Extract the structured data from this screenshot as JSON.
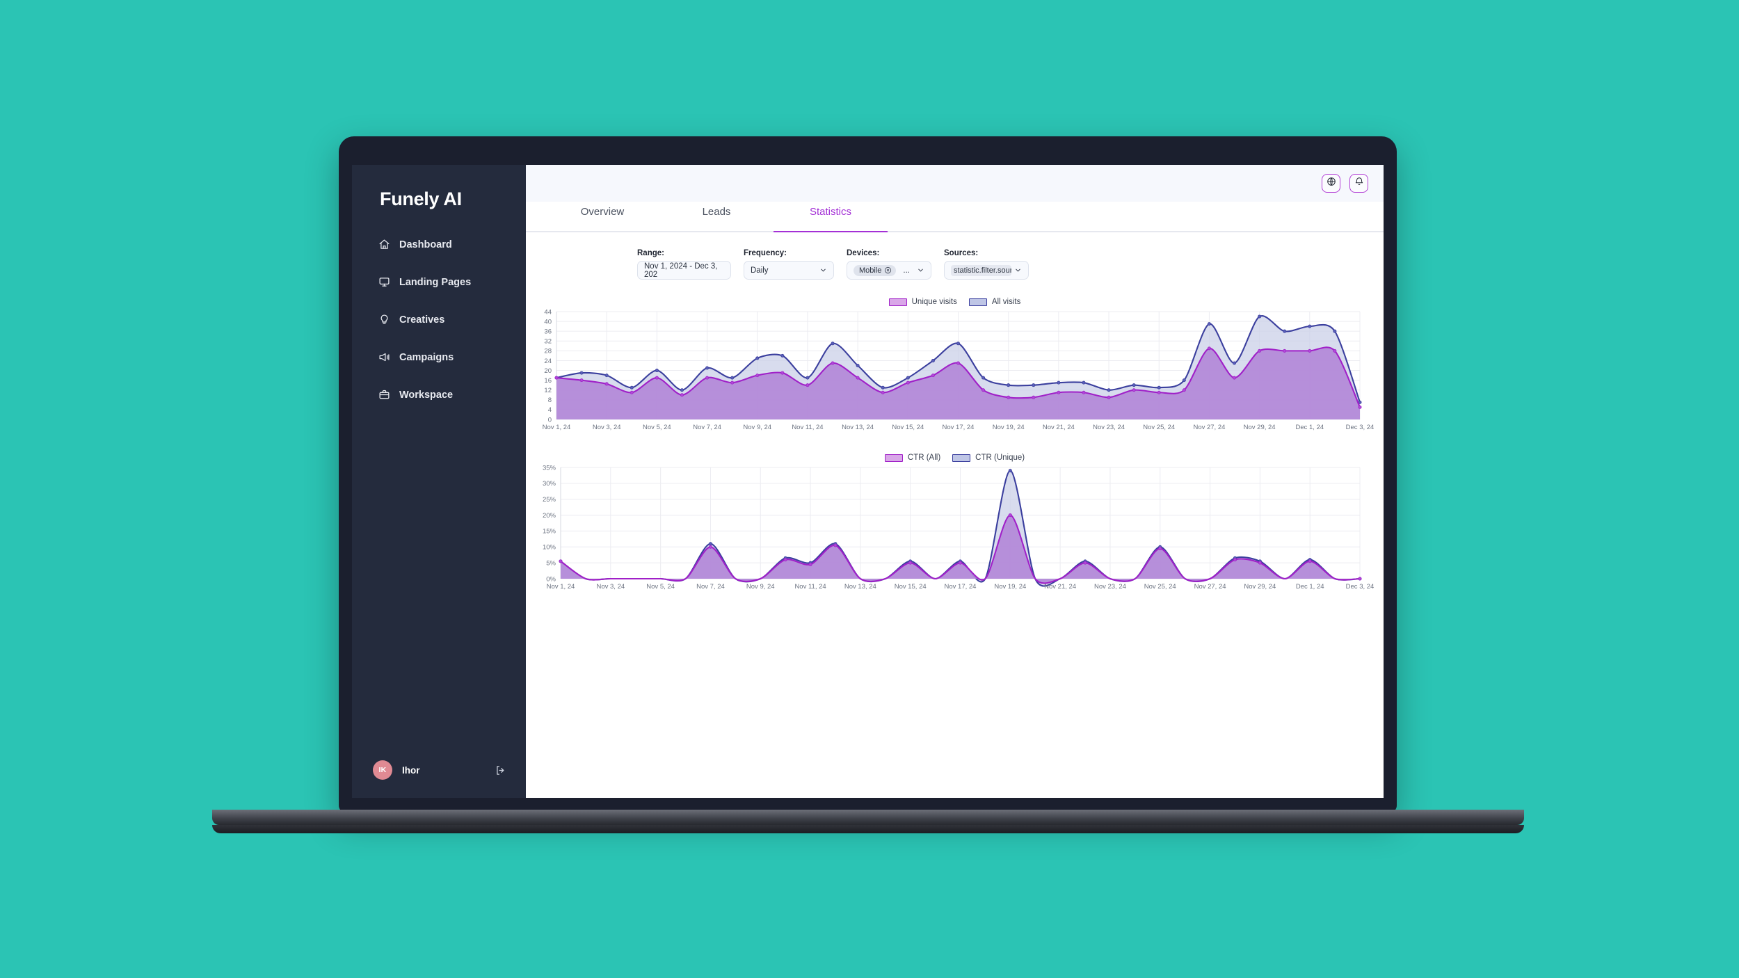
{
  "brand": {
    "name": "Funely AI"
  },
  "sidebar": {
    "items": [
      {
        "label": "Dashboard",
        "icon": "home-icon"
      },
      {
        "label": "Landing Pages",
        "icon": "monitor-icon"
      },
      {
        "label": "Creatives",
        "icon": "lightbulb-icon"
      },
      {
        "label": "Campaigns",
        "icon": "megaphone-icon"
      },
      {
        "label": "Workspace",
        "icon": "briefcase-icon"
      }
    ],
    "user": {
      "initials": "IK",
      "name": "Ihor",
      "logout_icon": "logout-icon"
    }
  },
  "topbar": {
    "globe_icon": "globe-icon",
    "bell_icon": "bell-icon",
    "accent": "#a431d6"
  },
  "tabs": [
    {
      "label": "Overview",
      "active": false
    },
    {
      "label": "Leads",
      "active": false
    },
    {
      "label": "Statistics",
      "active": true
    }
  ],
  "filters": {
    "range": {
      "label": "Range:",
      "value": "Nov 1, 2024 - Dec 3, 202"
    },
    "frequency": {
      "label": "Frequency:",
      "value": "Daily"
    },
    "devices": {
      "label": "Devices:",
      "chip": "Mobile",
      "overflow": "..."
    },
    "sources": {
      "label": "Sources:",
      "value": "statistic.filter.source"
    }
  },
  "chart_data": [
    {
      "type": "area",
      "title": "",
      "xlabel": "",
      "ylabel": "",
      "ylim": [
        0,
        44
      ],
      "yticks": [
        0,
        4,
        8,
        12,
        16,
        20,
        24,
        28,
        32,
        36,
        40,
        44
      ],
      "grid": true,
      "legend_position": "top-center",
      "legend": [
        "Unique visits",
        "All visits"
      ],
      "colors": {
        "Unique visits": "#a020c8",
        "All visits": "#3b3f9e"
      },
      "categories": [
        "Nov 1, 24",
        "Nov 2, 24",
        "Nov 3, 24",
        "Nov 4, 24",
        "Nov 5, 24",
        "Nov 6, 24",
        "Nov 7, 24",
        "Nov 8, 24",
        "Nov 9, 24",
        "Nov 10, 24",
        "Nov 11, 24",
        "Nov 12, 24",
        "Nov 13, 24",
        "Nov 14, 24",
        "Nov 15, 24",
        "Nov 16, 24",
        "Nov 17, 24",
        "Nov 18, 24",
        "Nov 19, 24",
        "Nov 20, 24",
        "Nov 21, 24",
        "Nov 22, 24",
        "Nov 23, 24",
        "Nov 24, 24",
        "Nov 25, 24",
        "Nov 26, 24",
        "Nov 27, 24",
        "Nov 28, 24",
        "Nov 29, 24",
        "Nov 30, 24",
        "Dec 1, 24",
        "Dec 2, 24",
        "Dec 3, 24"
      ],
      "xticks": [
        "Nov 1, 24",
        "Nov 3, 24",
        "Nov 5, 24",
        "Nov 7, 24",
        "Nov 9, 24",
        "Nov 11, 24",
        "Nov 13, 24",
        "Nov 15, 24",
        "Nov 17, 24",
        "Nov 19, 24",
        "Nov 21, 24",
        "Nov 23, 24",
        "Nov 25, 24",
        "Nov 27, 24",
        "Nov 29, 24",
        "Dec 1, 24",
        "Dec 3, 24"
      ],
      "series": [
        {
          "name": "All visits",
          "values": [
            17,
            19,
            18,
            13,
            20,
            12,
            21,
            17,
            25,
            26,
            17,
            31,
            22,
            13,
            17,
            24,
            31,
            17,
            14,
            14,
            15,
            15,
            12,
            14,
            13,
            16,
            39,
            23,
            42,
            36,
            38,
            36,
            7
          ]
        },
        {
          "name": "Unique visits",
          "values": [
            17,
            16,
            14.5,
            11,
            17,
            10,
            17,
            15,
            18,
            19,
            14,
            23,
            17,
            11,
            15,
            18,
            23,
            12,
            9,
            9,
            11,
            11,
            9,
            12,
            11,
            12,
            29,
            17,
            28,
            28,
            28,
            28,
            5
          ]
        }
      ]
    },
    {
      "type": "area",
      "title": "",
      "xlabel": "",
      "ylabel": "",
      "ylim": [
        0,
        35
      ],
      "yticks": [
        0,
        5,
        10,
        15,
        20,
        25,
        30,
        35
      ],
      "ytick_labels": [
        "0%",
        "5%",
        "10%",
        "15%",
        "20%",
        "25%",
        "30%",
        "35%"
      ],
      "grid": true,
      "legend_position": "top-center",
      "legend": [
        "CTR (All)",
        "CTR (Unique)"
      ],
      "colors": {
        "CTR (All)": "#a020c8",
        "CTR (Unique)": "#3b3f9e"
      },
      "categories": [
        "Nov 1, 24",
        "Nov 2, 24",
        "Nov 3, 24",
        "Nov 4, 24",
        "Nov 5, 24",
        "Nov 6, 24",
        "Nov 7, 24",
        "Nov 8, 24",
        "Nov 9, 24",
        "Nov 10, 24",
        "Nov 11, 24",
        "Nov 12, 24",
        "Nov 13, 24",
        "Nov 14, 24",
        "Nov 15, 24",
        "Nov 16, 24",
        "Nov 17, 24",
        "Nov 18, 24",
        "Nov 19, 24",
        "Nov 20, 24",
        "Nov 21, 24",
        "Nov 22, 24",
        "Nov 23, 24",
        "Nov 24, 24",
        "Nov 25, 24",
        "Nov 26, 24",
        "Nov 27, 24",
        "Nov 28, 24",
        "Nov 29, 24",
        "Nov 30, 24",
        "Dec 1, 24",
        "Dec 2, 24",
        "Dec 3, 24"
      ],
      "xticks": [
        "Nov 1, 24",
        "Nov 3, 24",
        "Nov 5, 24",
        "Nov 7, 24",
        "Nov 9, 24",
        "Nov 11, 24",
        "Nov 13, 24",
        "Nov 15, 24",
        "Nov 17, 24",
        "Nov 19, 24",
        "Nov 21, 24",
        "Nov 23, 24",
        "Nov 25, 24",
        "Nov 27, 24",
        "Nov 29, 24",
        "Dec 1, 24",
        "Dec 3, 24"
      ],
      "series": [
        {
          "name": "CTR (Unique)",
          "values": [
            5.5,
            0,
            0,
            0,
            0,
            0,
            11,
            0,
            0,
            6.5,
            5,
            11,
            0,
            0,
            5.5,
            0,
            5.5,
            0,
            34,
            0,
            0,
            5.5,
            0,
            0,
            10,
            0,
            0,
            6.5,
            5.5,
            0,
            6,
            0,
            0
          ]
        },
        {
          "name": "CTR (All)",
          "values": [
            5.5,
            0,
            0,
            0,
            0,
            0,
            10,
            0,
            0,
            6,
            4.5,
            10.5,
            0,
            0,
            5,
            0,
            5,
            0,
            20,
            0,
            0,
            5,
            0,
            0,
            9.5,
            0,
            0,
            6,
            5,
            0,
            5.5,
            0,
            0
          ]
        }
      ]
    }
  ]
}
